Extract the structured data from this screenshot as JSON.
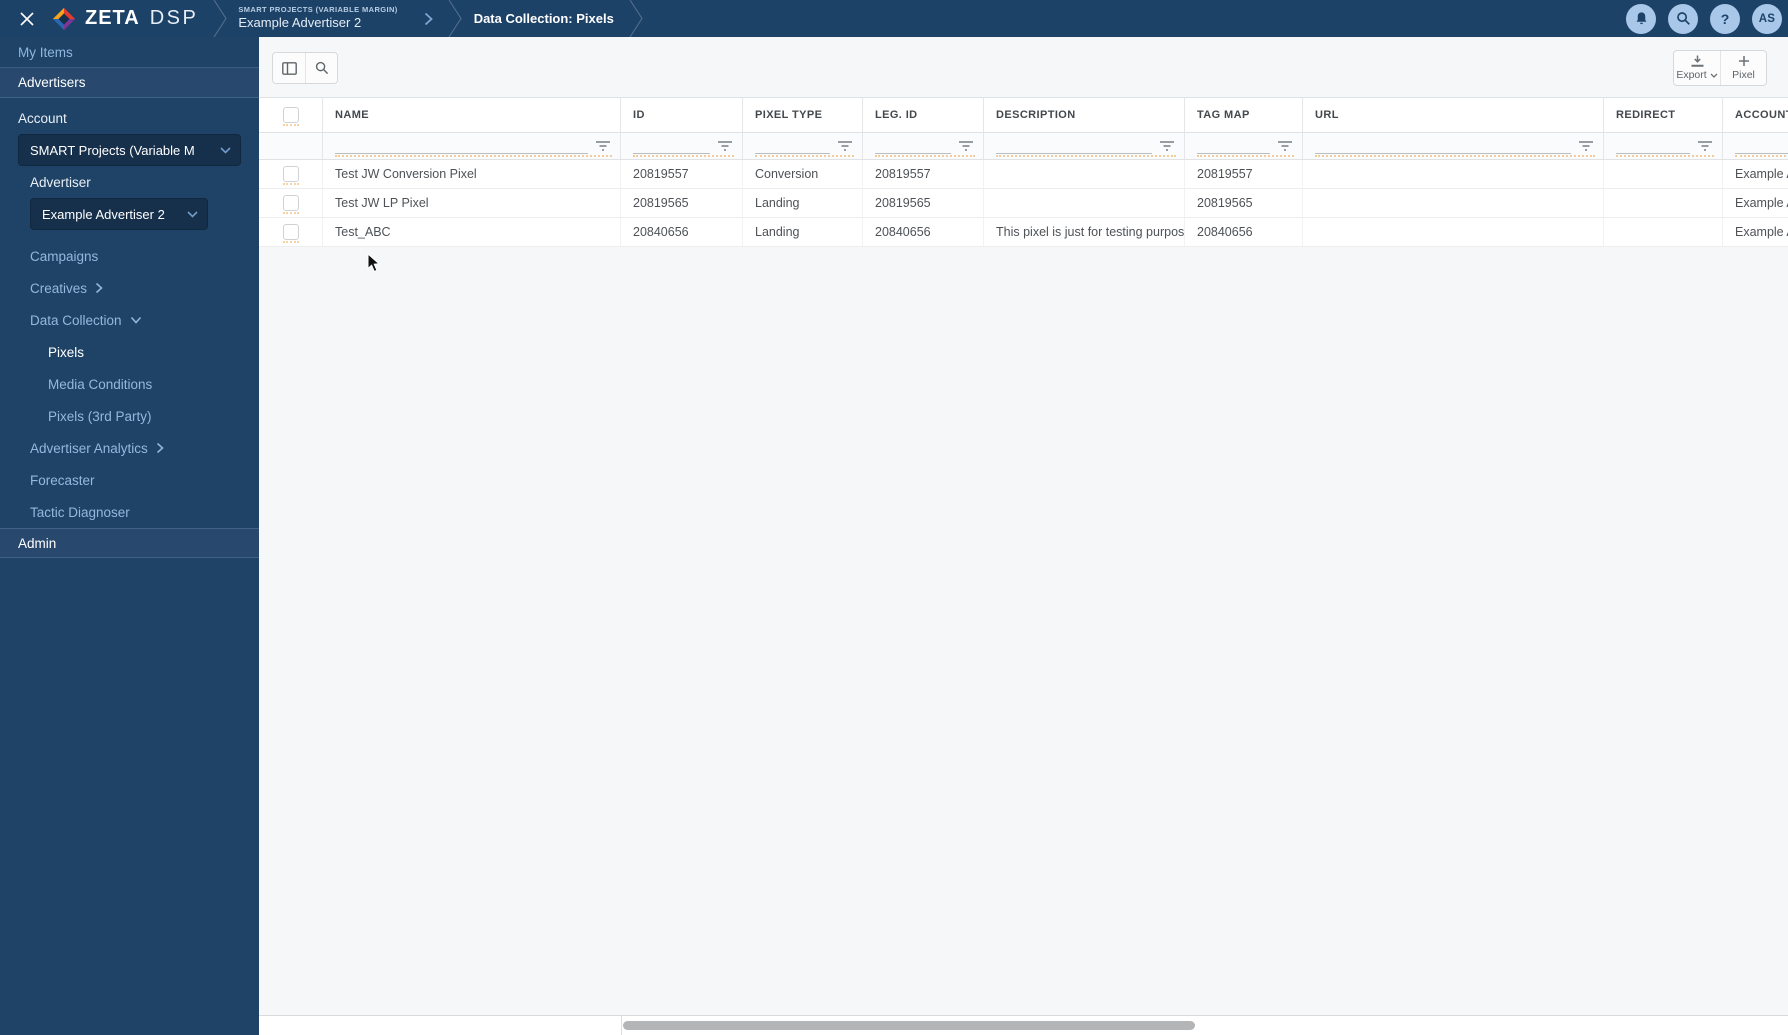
{
  "topbar": {
    "brand": "ZETA",
    "brand_suffix": "DSP",
    "breadcrumb": {
      "eyebrow": "SMART PROJECTS (VARIABLE MARGIN)",
      "advertiser": "Example Advertiser 2",
      "page": "Data Collection: Pixels"
    },
    "help_glyph": "?",
    "avatar_initials": "AS"
  },
  "sidebar": {
    "my_items": "My Items",
    "advertisers": "Advertisers",
    "account_label": "Account",
    "account_value": "SMART Projects (Variable M",
    "advertiser_label": "Advertiser",
    "advertiser_value": "Example Advertiser 2",
    "nav": [
      {
        "label": "Campaigns"
      },
      {
        "label": "Creatives"
      },
      {
        "label": "Data Collection"
      },
      {
        "label": "Pixels"
      },
      {
        "label": "Media Conditions"
      },
      {
        "label": "Pixels (3rd Party)"
      },
      {
        "label": "Advertiser Analytics"
      },
      {
        "label": "Forecaster"
      },
      {
        "label": "Tactic Diagnoser"
      }
    ],
    "admin": "Admin"
  },
  "toolbar": {
    "export_label": "Export",
    "pixel_label": "Pixel"
  },
  "table": {
    "columns": [
      "NAME",
      "ID",
      "PIXEL TYPE",
      "LEG. ID",
      "DESCRIPTION",
      "TAG MAP",
      "URL",
      "REDIRECT",
      "ACCOUNT"
    ],
    "rows": [
      {
        "name": "Test JW Conversion Pixel",
        "id": "20819557",
        "pixel_type": "Conversion",
        "leg_id": "20819557",
        "description": "",
        "tag_map": "20819557",
        "url": "",
        "redirect": "",
        "account": "Example A"
      },
      {
        "name": "Test JW LP Pixel",
        "id": "20819565",
        "pixel_type": "Landing",
        "leg_id": "20819565",
        "description": "",
        "tag_map": "20819565",
        "url": "",
        "redirect": "",
        "account": "Example A"
      },
      {
        "name": "Test_ABC",
        "id": "20840656",
        "pixel_type": "Landing",
        "leg_id": "20840656",
        "description": "This pixel is just for testing purpose",
        "tag_map": "20840656",
        "url": "",
        "redirect": "",
        "account": "Example A"
      }
    ]
  },
  "colors": {
    "topbar_navy": "#1d4268",
    "sidebar_navy": "#1f4366",
    "sidebar_highlight": "#28496d",
    "link_blue": "#8fb6de",
    "icon_circle_blue": "#a9c7e9",
    "logo_orange": "#f7a21b",
    "logo_red": "#e43b2c",
    "logo_blue": "#2b67b1",
    "logo_purple": "#7a3896"
  }
}
